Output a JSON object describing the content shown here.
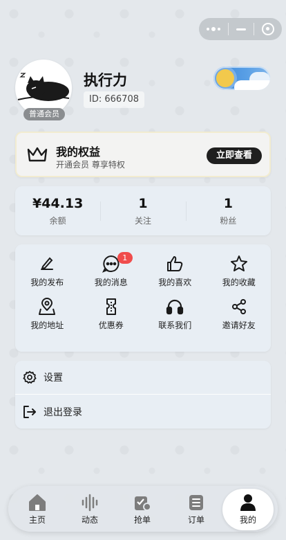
{
  "capsule": {
    "more_icon": "more-dots-icon",
    "minimize_icon": "minus-icon",
    "close_icon": "target-icon"
  },
  "profile": {
    "name": "执行力",
    "id_text": "ID: 666708",
    "member_badge": "普通会员",
    "avatar_icon": "cartoon-cat-avatar"
  },
  "weather_toggle_icon": "sun-cloud-toggle-icon",
  "rights": {
    "title": "我的权益",
    "subtitle": "开通会员 尊享特权",
    "button": "立即查看",
    "icon": "crown-icon"
  },
  "stats": [
    {
      "value": "¥44.13",
      "label": "余额"
    },
    {
      "value": "1",
      "label": "关注"
    },
    {
      "value": "1",
      "label": "粉丝"
    }
  ],
  "grid": [
    {
      "label": "我的发布",
      "icon": "write-icon"
    },
    {
      "label": "我的消息",
      "icon": "message-icon",
      "badge": "1"
    },
    {
      "label": "我的喜欢",
      "icon": "thumbs-up-icon"
    },
    {
      "label": "我的收藏",
      "icon": "star-icon"
    },
    {
      "label": "我的地址",
      "icon": "map-pin-icon"
    },
    {
      "label": "优惠券",
      "icon": "coupon-icon"
    },
    {
      "label": "联系我们",
      "icon": "headphones-icon"
    },
    {
      "label": "邀请好友",
      "icon": "share-icon"
    }
  ],
  "menu": [
    {
      "label": "设置",
      "icon": "gear-icon"
    },
    {
      "label": "退出登录",
      "icon": "logout-icon"
    }
  ],
  "tabs": [
    {
      "label": "主页",
      "icon": "home-icon"
    },
    {
      "label": "动态",
      "icon": "sound-wave-icon"
    },
    {
      "label": "抢单",
      "icon": "grab-order-icon"
    },
    {
      "label": "订单",
      "icon": "order-list-icon"
    },
    {
      "label": "我的",
      "icon": "user-icon",
      "active": true
    }
  ]
}
